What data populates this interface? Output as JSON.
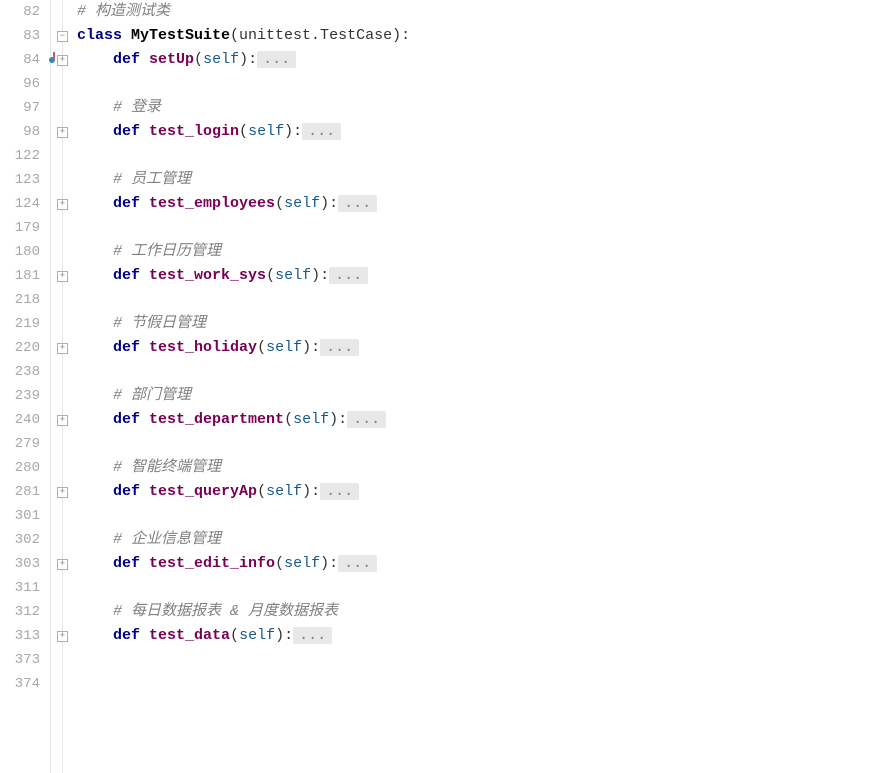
{
  "colors": {
    "keyword": "#000080",
    "function": "#7a0055",
    "param": "#1a5a8a",
    "comment": "#808080",
    "gutter": "#a8a8a8",
    "fold_bg": "#e8e8e8"
  },
  "lines": [
    {
      "n": "82",
      "fold": "",
      "indent": "",
      "tokens": [
        {
          "t": "comment",
          "v": "# 构造测试类"
        }
      ]
    },
    {
      "n": "83",
      "fold": "minus",
      "indent": "",
      "tokens": [
        {
          "t": "kw",
          "v": "class "
        },
        {
          "t": "cls",
          "v": "MyTestSuite"
        },
        {
          "t": "punct",
          "v": "(unittest.TestCase):"
        }
      ]
    },
    {
      "n": "84",
      "fold": "plus",
      "mod": true,
      "indent": "    ",
      "tokens": [
        {
          "t": "kw",
          "v": "def "
        },
        {
          "t": "fn",
          "v": "setUp"
        },
        {
          "t": "punct",
          "v": "("
        },
        {
          "t": "param",
          "v": "self"
        },
        {
          "t": "punct",
          "v": "):"
        },
        {
          "t": "folded",
          "v": "..."
        }
      ]
    },
    {
      "n": "96",
      "fold": "",
      "indent": "",
      "tokens": []
    },
    {
      "n": "97",
      "fold": "",
      "indent": "    ",
      "tokens": [
        {
          "t": "comment",
          "v": "# 登录"
        }
      ]
    },
    {
      "n": "98",
      "fold": "plus",
      "indent": "    ",
      "tokens": [
        {
          "t": "kw",
          "v": "def "
        },
        {
          "t": "fn",
          "v": "test_login"
        },
        {
          "t": "punct",
          "v": "("
        },
        {
          "t": "param",
          "v": "self"
        },
        {
          "t": "punct",
          "v": "):"
        },
        {
          "t": "folded",
          "v": "..."
        }
      ]
    },
    {
      "n": "122",
      "fold": "",
      "indent": "",
      "tokens": []
    },
    {
      "n": "123",
      "fold": "",
      "indent": "    ",
      "tokens": [
        {
          "t": "comment",
          "v": "# 员工管理"
        }
      ]
    },
    {
      "n": "124",
      "fold": "plus",
      "indent": "    ",
      "tokens": [
        {
          "t": "kw",
          "v": "def "
        },
        {
          "t": "fn",
          "v": "test_employees"
        },
        {
          "t": "punct",
          "v": "("
        },
        {
          "t": "param",
          "v": "self"
        },
        {
          "t": "punct",
          "v": "):"
        },
        {
          "t": "folded",
          "v": "..."
        }
      ]
    },
    {
      "n": "179",
      "fold": "",
      "indent": "",
      "tokens": []
    },
    {
      "n": "180",
      "fold": "",
      "indent": "    ",
      "tokens": [
        {
          "t": "comment",
          "v": "# 工作日历管理"
        }
      ]
    },
    {
      "n": "181",
      "fold": "plus",
      "indent": "    ",
      "tokens": [
        {
          "t": "kw",
          "v": "def "
        },
        {
          "t": "fn",
          "v": "test_work_sys"
        },
        {
          "t": "punct",
          "v": "("
        },
        {
          "t": "param",
          "v": "self"
        },
        {
          "t": "punct",
          "v": "):"
        },
        {
          "t": "folded",
          "v": "..."
        }
      ]
    },
    {
      "n": "218",
      "fold": "",
      "indent": "",
      "tokens": []
    },
    {
      "n": "219",
      "fold": "",
      "indent": "    ",
      "tokens": [
        {
          "t": "comment",
          "v": "# 节假日管理"
        }
      ]
    },
    {
      "n": "220",
      "fold": "plus",
      "indent": "    ",
      "tokens": [
        {
          "t": "kw",
          "v": "def "
        },
        {
          "t": "fn",
          "v": "test_holiday"
        },
        {
          "t": "punct",
          "v": "("
        },
        {
          "t": "param",
          "v": "self"
        },
        {
          "t": "punct",
          "v": "):"
        },
        {
          "t": "folded",
          "v": "..."
        }
      ]
    },
    {
      "n": "238",
      "fold": "",
      "indent": "",
      "tokens": []
    },
    {
      "n": "239",
      "fold": "",
      "indent": "    ",
      "tokens": [
        {
          "t": "comment",
          "v": "# 部门管理"
        }
      ]
    },
    {
      "n": "240",
      "fold": "plus",
      "indent": "    ",
      "tokens": [
        {
          "t": "kw",
          "v": "def "
        },
        {
          "t": "fn",
          "v": "test_department"
        },
        {
          "t": "punct",
          "v": "("
        },
        {
          "t": "param",
          "v": "self"
        },
        {
          "t": "punct",
          "v": "):"
        },
        {
          "t": "folded",
          "v": "..."
        }
      ]
    },
    {
      "n": "279",
      "fold": "",
      "indent": "",
      "tokens": []
    },
    {
      "n": "280",
      "fold": "",
      "indent": "    ",
      "tokens": [
        {
          "t": "comment",
          "v": "# 智能终端管理"
        }
      ]
    },
    {
      "n": "281",
      "fold": "plus",
      "indent": "    ",
      "tokens": [
        {
          "t": "kw",
          "v": "def "
        },
        {
          "t": "fn",
          "v": "test_queryAp"
        },
        {
          "t": "punct",
          "v": "("
        },
        {
          "t": "param",
          "v": "self"
        },
        {
          "t": "punct",
          "v": "):"
        },
        {
          "t": "folded",
          "v": "..."
        }
      ]
    },
    {
      "n": "301",
      "fold": "",
      "indent": "",
      "tokens": []
    },
    {
      "n": "302",
      "fold": "",
      "indent": "    ",
      "tokens": [
        {
          "t": "comment",
          "v": "# 企业信息管理"
        }
      ]
    },
    {
      "n": "303",
      "fold": "plus",
      "indent": "    ",
      "tokens": [
        {
          "t": "kw",
          "v": "def "
        },
        {
          "t": "fn",
          "v": "test_edit_info"
        },
        {
          "t": "punct",
          "v": "("
        },
        {
          "t": "param",
          "v": "self"
        },
        {
          "t": "punct",
          "v": "):"
        },
        {
          "t": "folded",
          "v": "..."
        }
      ]
    },
    {
      "n": "311",
      "fold": "",
      "indent": "",
      "tokens": []
    },
    {
      "n": "312",
      "fold": "",
      "indent": "    ",
      "tokens": [
        {
          "t": "comment",
          "v": "# 每日数据报表 & 月度数据报表"
        }
      ]
    },
    {
      "n": "313",
      "fold": "plus",
      "indent": "    ",
      "tokens": [
        {
          "t": "kw",
          "v": "def "
        },
        {
          "t": "fn",
          "v": "test_data"
        },
        {
          "t": "punct",
          "v": "("
        },
        {
          "t": "param",
          "v": "self"
        },
        {
          "t": "punct",
          "v": "):"
        },
        {
          "t": "folded",
          "v": "..."
        }
      ]
    },
    {
      "n": "373",
      "fold": "",
      "indent": "",
      "tokens": []
    },
    {
      "n": "374",
      "fold": "",
      "indent": "",
      "tokens": []
    }
  ]
}
